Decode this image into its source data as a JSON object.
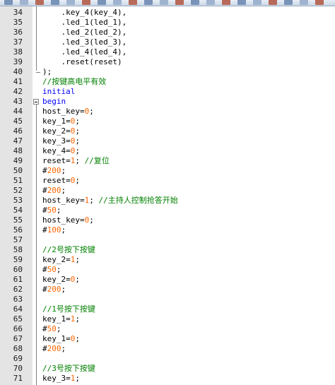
{
  "toolbar": {
    "icons": [
      "undo-icon",
      "redo-icon",
      "print-icon",
      "cut-icon",
      "copy-icon",
      "paste-icon",
      "delete-icon",
      "indent-icon",
      "outdent-icon",
      "find-icon",
      "replace-icon",
      "macro-icon",
      "zoom-icon",
      "doc-icon",
      "stop-icon",
      "record-icon",
      "play-icon",
      "ansi-icon",
      "wrap-icon",
      "view-icon",
      "settings-icon"
    ],
    "accent": "#c9d6e6"
  },
  "colors": {
    "keyword": "#0000ff",
    "number": "#ff6600",
    "comment": "#008000",
    "text": "#000000"
  },
  "lines": [
    {
      "num": "34",
      "indent": "    ",
      "tokens": [
        {
          "t": "plain",
          "v": ".key_4(key_4),"
        }
      ]
    },
    {
      "num": "35",
      "indent": "    ",
      "tokens": [
        {
          "t": "plain",
          "v": ".led_1(led_1),"
        }
      ]
    },
    {
      "num": "36",
      "indent": "    ",
      "tokens": [
        {
          "t": "plain",
          "v": ".led_2(led_2),"
        }
      ]
    },
    {
      "num": "37",
      "indent": "    ",
      "tokens": [
        {
          "t": "plain",
          "v": ".led_3(led_3),"
        }
      ]
    },
    {
      "num": "38",
      "indent": "    ",
      "tokens": [
        {
          "t": "plain",
          "v": ".led_4(led_4),"
        }
      ]
    },
    {
      "num": "39",
      "indent": "    ",
      "tokens": [
        {
          "t": "plain",
          "v": ".reset(reset)"
        }
      ]
    },
    {
      "num": "40",
      "indent": "",
      "tokens": [
        {
          "t": "plain",
          "v": ");"
        }
      ]
    },
    {
      "num": "41",
      "indent": "",
      "tokens": [
        {
          "t": "cm",
          "v": "//按键高电平有效"
        }
      ]
    },
    {
      "num": "42",
      "indent": "",
      "tokens": [
        {
          "t": "kw",
          "v": "initial"
        }
      ]
    },
    {
      "num": "43",
      "indent": "",
      "tokens": [
        {
          "t": "kw",
          "v": "begin"
        }
      ]
    },
    {
      "num": "44",
      "indent": "",
      "tokens": [
        {
          "t": "plain",
          "v": "host_key="
        },
        {
          "t": "num",
          "v": "0"
        },
        {
          "t": "plain",
          "v": ";"
        }
      ]
    },
    {
      "num": "45",
      "indent": "",
      "tokens": [
        {
          "t": "plain",
          "v": "key_1="
        },
        {
          "t": "num",
          "v": "0"
        },
        {
          "t": "plain",
          "v": ";"
        }
      ]
    },
    {
      "num": "46",
      "indent": "",
      "tokens": [
        {
          "t": "plain",
          "v": "key_2="
        },
        {
          "t": "num",
          "v": "0"
        },
        {
          "t": "plain",
          "v": ";"
        }
      ]
    },
    {
      "num": "47",
      "indent": "",
      "tokens": [
        {
          "t": "plain",
          "v": "key_3="
        },
        {
          "t": "num",
          "v": "0"
        },
        {
          "t": "plain",
          "v": ";"
        }
      ]
    },
    {
      "num": "48",
      "indent": "",
      "tokens": [
        {
          "t": "plain",
          "v": "key_4="
        },
        {
          "t": "num",
          "v": "0"
        },
        {
          "t": "plain",
          "v": ";"
        }
      ]
    },
    {
      "num": "49",
      "indent": "",
      "tokens": [
        {
          "t": "plain",
          "v": "reset="
        },
        {
          "t": "num",
          "v": "1"
        },
        {
          "t": "plain",
          "v": "; "
        },
        {
          "t": "cm",
          "v": "//复位"
        }
      ]
    },
    {
      "num": "50",
      "indent": "",
      "tokens": [
        {
          "t": "plain",
          "v": "#"
        },
        {
          "t": "num",
          "v": "200"
        },
        {
          "t": "plain",
          "v": ";"
        }
      ]
    },
    {
      "num": "51",
      "indent": "",
      "tokens": [
        {
          "t": "plain",
          "v": "reset="
        },
        {
          "t": "num",
          "v": "0"
        },
        {
          "t": "plain",
          "v": ";"
        }
      ]
    },
    {
      "num": "52",
      "indent": "",
      "tokens": [
        {
          "t": "plain",
          "v": "#"
        },
        {
          "t": "num",
          "v": "200"
        },
        {
          "t": "plain",
          "v": ";"
        }
      ]
    },
    {
      "num": "53",
      "indent": "",
      "tokens": [
        {
          "t": "plain",
          "v": "host_key="
        },
        {
          "t": "num",
          "v": "1"
        },
        {
          "t": "plain",
          "v": "; "
        },
        {
          "t": "cm",
          "v": "//主持人控制抢答开始"
        }
      ]
    },
    {
      "num": "54",
      "indent": "",
      "tokens": [
        {
          "t": "plain",
          "v": "#"
        },
        {
          "t": "num",
          "v": "50"
        },
        {
          "t": "plain",
          "v": ";"
        }
      ]
    },
    {
      "num": "55",
      "indent": "",
      "tokens": [
        {
          "t": "plain",
          "v": "host_key="
        },
        {
          "t": "num",
          "v": "0"
        },
        {
          "t": "plain",
          "v": ";"
        }
      ]
    },
    {
      "num": "56",
      "indent": "",
      "tokens": [
        {
          "t": "plain",
          "v": "#"
        },
        {
          "t": "num",
          "v": "100"
        },
        {
          "t": "plain",
          "v": ";"
        }
      ]
    },
    {
      "num": "57",
      "indent": "",
      "tokens": []
    },
    {
      "num": "58",
      "indent": "",
      "tokens": [
        {
          "t": "cm",
          "v": "//2号按下按键"
        }
      ]
    },
    {
      "num": "59",
      "indent": "",
      "tokens": [
        {
          "t": "plain",
          "v": "key_2="
        },
        {
          "t": "num",
          "v": "1"
        },
        {
          "t": "plain",
          "v": ";"
        }
      ]
    },
    {
      "num": "60",
      "indent": "",
      "tokens": [
        {
          "t": "plain",
          "v": "#"
        },
        {
          "t": "num",
          "v": "50"
        },
        {
          "t": "plain",
          "v": ";"
        }
      ]
    },
    {
      "num": "61",
      "indent": "",
      "tokens": [
        {
          "t": "plain",
          "v": "key_2="
        },
        {
          "t": "num",
          "v": "0"
        },
        {
          "t": "plain",
          "v": ";"
        }
      ]
    },
    {
      "num": "62",
      "indent": "",
      "tokens": [
        {
          "t": "plain",
          "v": "#"
        },
        {
          "t": "num",
          "v": "200"
        },
        {
          "t": "plain",
          "v": ";"
        }
      ]
    },
    {
      "num": "63",
      "indent": "",
      "tokens": []
    },
    {
      "num": "64",
      "indent": "",
      "tokens": [
        {
          "t": "cm",
          "v": "//1号按下按键"
        }
      ]
    },
    {
      "num": "65",
      "indent": "",
      "tokens": [
        {
          "t": "plain",
          "v": "key_1="
        },
        {
          "t": "num",
          "v": "1"
        },
        {
          "t": "plain",
          "v": ";"
        }
      ]
    },
    {
      "num": "66",
      "indent": "",
      "tokens": [
        {
          "t": "plain",
          "v": "#"
        },
        {
          "t": "num",
          "v": "50"
        },
        {
          "t": "plain",
          "v": ";"
        }
      ]
    },
    {
      "num": "67",
      "indent": "",
      "tokens": [
        {
          "t": "plain",
          "v": "key_1="
        },
        {
          "t": "num",
          "v": "0"
        },
        {
          "t": "plain",
          "v": ";"
        }
      ]
    },
    {
      "num": "68",
      "indent": "",
      "tokens": [
        {
          "t": "plain",
          "v": "#"
        },
        {
          "t": "num",
          "v": "200"
        },
        {
          "t": "plain",
          "v": ";"
        }
      ]
    },
    {
      "num": "69",
      "indent": "",
      "tokens": []
    },
    {
      "num": "70",
      "indent": "",
      "tokens": [
        {
          "t": "cm",
          "v": "//3号按下按键"
        }
      ]
    },
    {
      "num": "71",
      "indent": "",
      "tokens": [
        {
          "t": "plain",
          "v": "key_3="
        },
        {
          "t": "num",
          "v": "1"
        },
        {
          "t": "plain",
          "v": ";"
        }
      ]
    }
  ]
}
